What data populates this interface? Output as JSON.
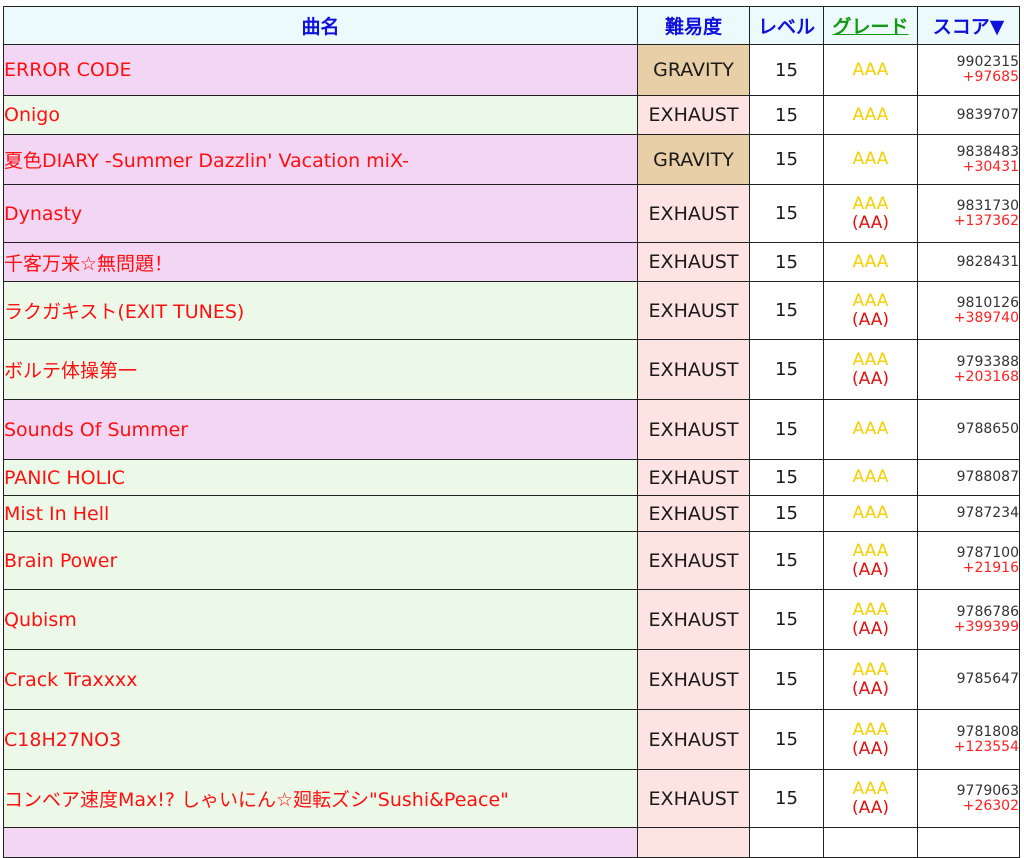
{
  "headers": {
    "name": "曲名",
    "difficulty": "難易度",
    "level": "レベル",
    "grade": "グレード",
    "score": "スコア▼"
  },
  "colors": {
    "row_pink": "#f2d6f4",
    "row_green": "#ecf9e9",
    "diff_gravity": "#e8cfa8",
    "diff_exhaust": "#fde3e1",
    "header_bg": "#ecfafc",
    "song_text": "#ff1010",
    "grade_aaa": "#f5d000",
    "grade_aa": "#e01010",
    "score_diff": "#ff2020"
  },
  "rows": [
    {
      "name": "ERROR CODE",
      "difficulty": "GRAVITY",
      "level": "15",
      "grade": "AAA",
      "grade_sub": "",
      "score": "9902315",
      "score_diff": "+97685",
      "bg": "pink",
      "h": 51
    },
    {
      "name": "Onigo",
      "difficulty": "EXHAUST",
      "level": "15",
      "grade": "AAA",
      "grade_sub": "",
      "score": "9839707",
      "score_diff": "",
      "bg": "green",
      "h": 39
    },
    {
      "name": "夏色DIARY -Summer Dazzlin' Vacation miX-",
      "difficulty": "GRAVITY",
      "level": "15",
      "grade": "AAA",
      "grade_sub": "",
      "score": "9838483",
      "score_diff": "+30431",
      "bg": "pink",
      "h": 50
    },
    {
      "name": "Dynasty",
      "difficulty": "EXHAUST",
      "level": "15",
      "grade": "AAA",
      "grade_sub": "(AA)",
      "score": "9831730",
      "score_diff": "+137362",
      "bg": "pink",
      "h": 58
    },
    {
      "name": "千客万来☆無問題！",
      "difficulty": "EXHAUST",
      "level": "15",
      "grade": "AAA",
      "grade_sub": "",
      "score": "9828431",
      "score_diff": "",
      "bg": "pink",
      "h": 39
    },
    {
      "name": "ラクガキスト(EXIT TUNES)",
      "difficulty": "EXHAUST",
      "level": "15",
      "grade": "AAA",
      "grade_sub": "(AA)",
      "score": "9810126",
      "score_diff": "+389740",
      "bg": "green",
      "h": 58
    },
    {
      "name": "ボルテ体操第一",
      "difficulty": "EXHAUST",
      "level": "15",
      "grade": "AAA",
      "grade_sub": "(AA)",
      "score": "9793388",
      "score_diff": "+203168",
      "bg": "green",
      "h": 60
    },
    {
      "name": "Sounds Of Summer",
      "difficulty": "EXHAUST",
      "level": "15",
      "grade": "AAA",
      "grade_sub": "",
      "score": "9788650",
      "score_diff": "",
      "bg": "pink",
      "h": 60
    },
    {
      "name": "PANIC HOLIC",
      "difficulty": "EXHAUST",
      "level": "15",
      "grade": "AAA",
      "grade_sub": "",
      "score": "9788087",
      "score_diff": "",
      "bg": "green",
      "h": 36
    },
    {
      "name": "Mist In Hell",
      "difficulty": "EXHAUST",
      "level": "15",
      "grade": "AAA",
      "grade_sub": "",
      "score": "9787234",
      "score_diff": "",
      "bg": "green",
      "h": 36
    },
    {
      "name": "Brain Power",
      "difficulty": "EXHAUST",
      "level": "15",
      "grade": "AAA",
      "grade_sub": "(AA)",
      "score": "9787100",
      "score_diff": "+21916",
      "bg": "green",
      "h": 58
    },
    {
      "name": "Qubism",
      "difficulty": "EXHAUST",
      "level": "15",
      "grade": "AAA",
      "grade_sub": "(AA)",
      "score": "9786786",
      "score_diff": "+399399",
      "bg": "green",
      "h": 60
    },
    {
      "name": "Crack Traxxxx",
      "difficulty": "EXHAUST",
      "level": "15",
      "grade": "AAA",
      "grade_sub": "(AA)",
      "score": "9785647",
      "score_diff": "",
      "bg": "green",
      "h": 60
    },
    {
      "name": "C18H27NO3",
      "difficulty": "EXHAUST",
      "level": "15",
      "grade": "AAA",
      "grade_sub": "(AA)",
      "score": "9781808",
      "score_diff": "+123554",
      "bg": "green",
      "h": 60
    },
    {
      "name": "コンベア速度Max!? しゃいにん☆廻転ズシ\"Sushi&Peace\"",
      "difficulty": "EXHAUST",
      "level": "15",
      "grade": "AAA",
      "grade_sub": "(AA)",
      "score": "9779063",
      "score_diff": "+26302",
      "bg": "green",
      "h": 58
    },
    {
      "name": "",
      "difficulty": "",
      "level": "",
      "grade": "",
      "grade_sub": "",
      "score": "",
      "score_diff": "",
      "bg": "pink",
      "h": 30
    }
  ]
}
